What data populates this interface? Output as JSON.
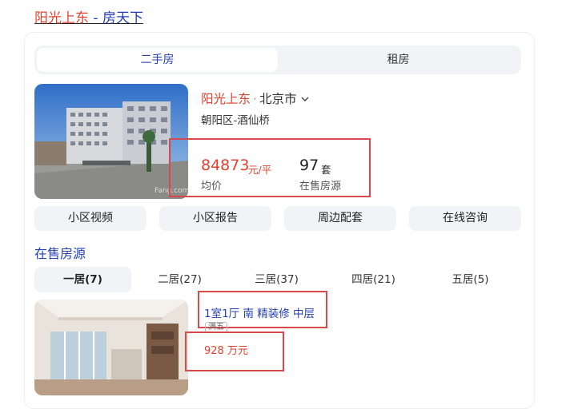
{
  "header": {
    "title_highlight": "阳光上东",
    "title_rest": " - 房天下"
  },
  "tabs": [
    {
      "label": "二手房",
      "active": true
    },
    {
      "label": "租房",
      "active": false
    }
  ],
  "community": {
    "name": "阳光上东",
    "separator": "·",
    "city": "北京市",
    "district": "朝阳区-酒仙桥",
    "watermark": "Fang.com",
    "avg_price": "84873",
    "avg_price_unit": "元/平",
    "avg_price_label": "均价",
    "listing_count": "97",
    "listing_count_unit": "套",
    "listing_count_label": "在售房源"
  },
  "actions": [
    "小区视频",
    "小区报告",
    "周边配套",
    "在线咨询"
  ],
  "section_title": "在售房源",
  "room_filters": [
    {
      "label": "一居(7)",
      "active": true
    },
    {
      "label": "二居(27)",
      "active": false
    },
    {
      "label": "三居(37)",
      "active": false
    },
    {
      "label": "四居(21)",
      "active": false
    },
    {
      "label": "五居(5)",
      "active": false
    }
  ],
  "listing": {
    "title": "1室1厅  南  精装修  中层",
    "tag": "满五",
    "price": "928 万元"
  },
  "colors": {
    "accent_red": "#e0422e",
    "link_blue": "#2440b3",
    "annotation_box": "#d9484a",
    "chip_bg": "#f1f3f6"
  }
}
